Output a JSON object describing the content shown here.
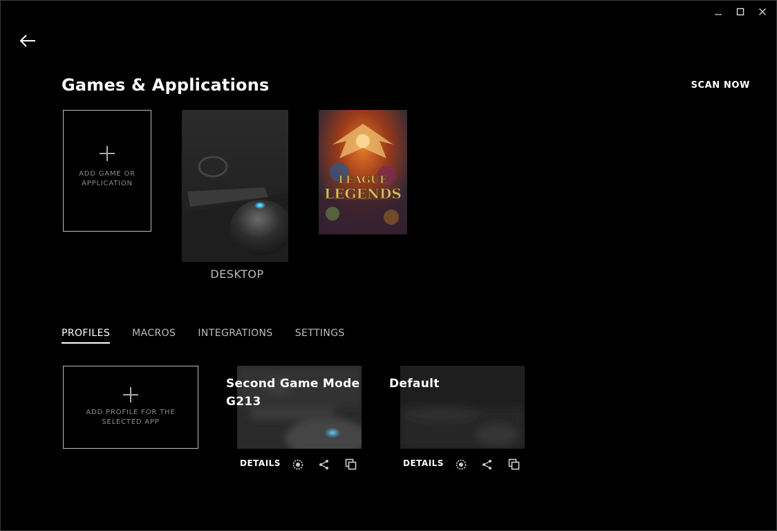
{
  "window_controls": {
    "minimize_icon": "minimize-icon",
    "maximize_icon": "maximize-icon",
    "close_icon": "close-icon"
  },
  "header": {
    "back_icon": "arrow-left-icon",
    "title": "Games & Applications",
    "scan_now_label": "SCAN NOW"
  },
  "games": {
    "add_label_line1": "ADD GAME OR",
    "add_label_line2": "APPLICATION",
    "items": [
      {
        "label": "DESKTOP",
        "image": "desktop-mouse-keyboard-photo"
      },
      {
        "label": "",
        "image": "league-of-legends-cover",
        "cover_text": "LEAGUE LEGENDS"
      }
    ]
  },
  "tabs": [
    {
      "label": "PROFILES",
      "active": true
    },
    {
      "label": "MACROS",
      "active": false
    },
    {
      "label": "INTEGRATIONS",
      "active": false
    },
    {
      "label": "SETTINGS",
      "active": false
    }
  ],
  "profiles": {
    "add_label_line1": "ADD PROFILE FOR THE",
    "add_label_line2": "SELECTED APP",
    "items": [
      {
        "title_line1": "Second Game Mode",
        "title_line2": "G213",
        "details_label": "DETAILS",
        "icons": [
          "persistent-profile-icon",
          "share-icon",
          "duplicate-icon"
        ]
      },
      {
        "title_line1": "Default",
        "title_line2": "",
        "details_label": "DETAILS",
        "icons": [
          "persistent-profile-icon",
          "share-icon",
          "duplicate-icon"
        ]
      }
    ]
  },
  "colors": {
    "background": "#000000",
    "text_primary": "#ffffff",
    "text_secondary": "#bdbdbd",
    "border": "#bdbdbd",
    "accent_glow": "#38b6e8"
  }
}
